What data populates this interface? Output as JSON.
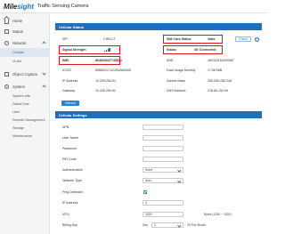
{
  "header": {
    "logo_main": "Milesight",
    "title": "Traffic Sensing Camera"
  },
  "sidebar": {
    "home": "Home",
    "status": "Status",
    "network": "Network",
    "network_sub": [
      "Cellular",
      "VLAN"
    ],
    "object_capture": "Object Capture",
    "system": "System",
    "system_sub": [
      "System Info",
      "Date&Time",
      "User",
      "Remote Management",
      "Storage",
      "Maintenance"
    ]
  },
  "cellular_status": {
    "header": "Cellular Status",
    "isp_label": "ISP",
    "isp_value": "CHN-CT",
    "sim_label": "SIM Card Status",
    "sim_value": "Valid",
    "check_button": "Check",
    "signal_label": "Signal Strength",
    "signal_level": 4,
    "status_label": "Status",
    "status_value": "4G Connected",
    "imei_label": "IMEI",
    "imei_value": "864694047745522",
    "imsi_label": "IMSI",
    "imsi_value": "460119154420087",
    "iccid_label": "ICCID",
    "iccid_value": "89860317141054584450",
    "data_usage_label": "Data Usage Monthly",
    "data_usage_value": "17.58 MiB",
    "ip_label": "IP Address",
    "ip_value": "10.209.254.51",
    "subnet_label": "Subnet Mask",
    "subnet_value": "255.255.255.248",
    "gateway_label": "Gateway",
    "gateway_value": "10.209.254.52",
    "dns_label": "DNS Address",
    "dns_value": "218.85.152.99",
    "refresh_button": "Refresh"
  },
  "cellular_settings": {
    "header": "Cellular Settings",
    "apn_label": "APN",
    "username_label": "User Name",
    "password_label": "Password",
    "pin_label": "PIN Code",
    "auth_label": "Authentication",
    "auth_value": "None",
    "network_type_label": "Network Type",
    "network_type_value": "Auto",
    "ping_label": "Ping Detection",
    "ping_checked": true,
    "ip_address_label": "IP Address",
    "ip_address_value": "0",
    "mtu_label": "MTU",
    "mtu_value": "1500",
    "mtu_hint": "Bytes (1280 ~ 1500)",
    "billing_label": "Billing Day",
    "billing_prefix": "Day",
    "billing_value": "1",
    "billing_suffix": "Of The Month"
  },
  "colors": {
    "accent": "#1f6fbf",
    "highlight": "#d11a1a",
    "sidebar_bg": "#f4f5f7"
  }
}
